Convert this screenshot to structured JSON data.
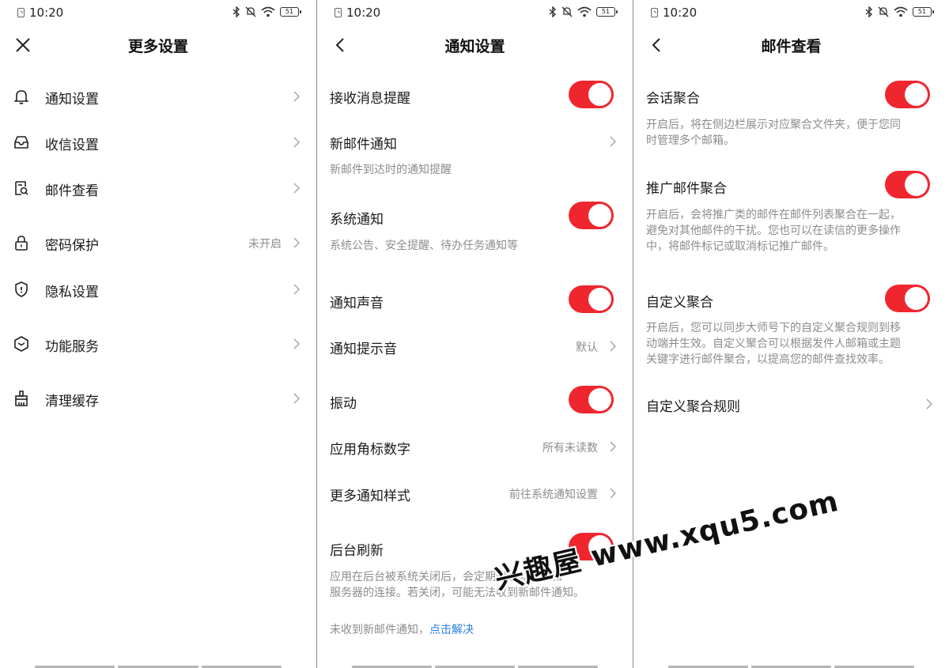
{
  "status_bar": {
    "time": "10:20",
    "battery": "51"
  },
  "panel1": {
    "title": "更多设置",
    "items": [
      {
        "label": "通知设置",
        "icon": "bell-icon"
      },
      {
        "label": "收信设置",
        "icon": "inbox-icon"
      },
      {
        "label": "邮件查看",
        "icon": "mail-view-icon"
      },
      {
        "label": "密码保护",
        "icon": "lock-icon",
        "value": "未开启"
      },
      {
        "label": "隐私设置",
        "icon": "shield-icon"
      },
      {
        "label": "功能服务",
        "icon": "box-icon"
      },
      {
        "label": "清理缓存",
        "icon": "broom-icon"
      }
    ]
  },
  "panel2": {
    "title": "通知设置",
    "items": [
      {
        "label": "接收消息提醒",
        "type": "toggle",
        "on": true
      },
      {
        "label": "新邮件通知",
        "type": "link",
        "desc": "新邮件到达时的通知提醒"
      },
      {
        "label": "系统通知",
        "type": "toggle",
        "on": true,
        "desc": "系统公告、安全提醒、待办任务通知等"
      },
      {
        "label": "通知声音",
        "type": "toggle",
        "on": true
      },
      {
        "label": "通知提示音",
        "type": "link",
        "value": "默认"
      },
      {
        "label": "振动",
        "type": "toggle",
        "on": true
      },
      {
        "label": "应用角标数字",
        "type": "link",
        "value": "所有未读数"
      },
      {
        "label": "更多通知样式",
        "type": "link",
        "value": "前往系统通知设置"
      },
      {
        "label": "后台刷新",
        "type": "toggle",
        "on": true,
        "desc_line1": "应用在后台被系统关闭后，会定期唤醒以保持和",
        "desc_line2": "服务器的连接。若关闭，可能无法收到新邮件通知。"
      }
    ],
    "footer_text": "未收到新邮件通知，",
    "footer_link": "点击解决"
  },
  "panel3": {
    "title": "邮件查看",
    "items": [
      {
        "label": "会话聚合",
        "type": "toggle",
        "on": true,
        "desc_line1": "开启后，将在侧边栏展示对应聚合文件夹，便于您同",
        "desc_line2": "时管理多个邮箱。"
      },
      {
        "label": "推广邮件聚合",
        "type": "toggle",
        "on": true,
        "desc_line1": "开启后，会将推广类的邮件在邮件列表聚合在一起，",
        "desc_line2": "避免对其他邮件的干扰。您也可以在读信的更多操作",
        "desc_line3": "中，将邮件标记或取消标记推广邮件。"
      },
      {
        "label": "自定义聚合",
        "type": "toggle",
        "on": true,
        "desc_line1": "开启后，您可以同步大师号下的自定义聚合规则到移",
        "desc_line2": "动端并生效。自定义聚合可以根据发件人邮箱或主题",
        "desc_line3": "关键字进行邮件聚合，以提高您的邮件查找效率。"
      },
      {
        "label": "自定义聚合规则",
        "type": "link"
      }
    ]
  },
  "watermark": "兴趣屋 www.xqu5.com",
  "colors": {
    "toggle_on": "#f0262f",
    "link": "#2a7de1",
    "secondary_text": "#8c8c8c"
  }
}
